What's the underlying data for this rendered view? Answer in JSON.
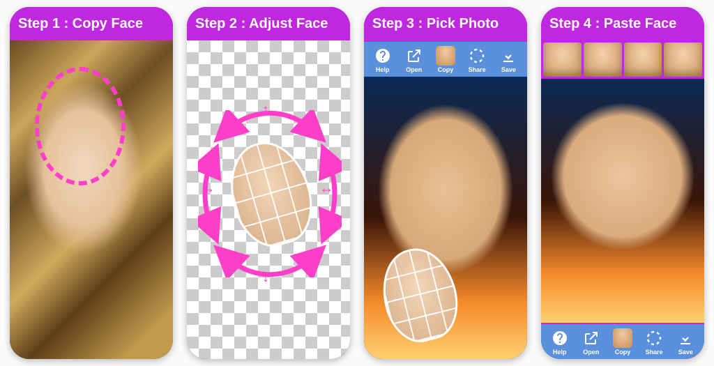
{
  "accent_color": "#c028e0",
  "pink": "#ff3fc8",
  "steps": [
    {
      "title": "Step 1 : Copy Face"
    },
    {
      "title": "Step 2 : Adjust Face"
    },
    {
      "title": "Step 3 : Pick Photo"
    },
    {
      "title": "Step 4 : Paste Face"
    }
  ],
  "toolbar": {
    "help": {
      "label": "Help",
      "icon": "help-icon"
    },
    "open": {
      "label": "Open",
      "icon": "open-icon"
    },
    "copy": {
      "label": "Copy",
      "icon": "face-thumb-icon"
    },
    "share": {
      "label": "Share",
      "icon": "share-icon"
    },
    "save": {
      "label": "Save",
      "icon": "download-icon"
    }
  },
  "face_thumbnails": [
    "face-1",
    "face-2",
    "face-3",
    "face-4"
  ]
}
